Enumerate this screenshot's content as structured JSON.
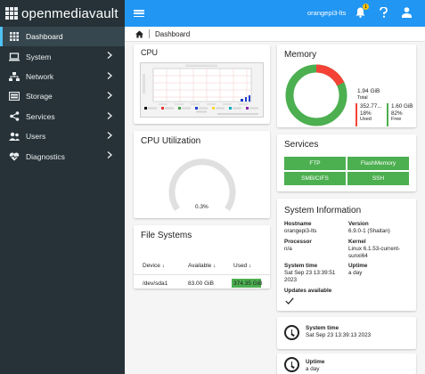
{
  "app": {
    "name": "openmediavault",
    "hostname": "orangepi3-lts",
    "notification_count": "1"
  },
  "sidebar": {
    "items": [
      {
        "label": "Dashboard",
        "icon": "dashboard-icon",
        "active": true
      },
      {
        "label": "System",
        "icon": "laptop-icon"
      },
      {
        "label": "Network",
        "icon": "network-icon"
      },
      {
        "label": "Storage",
        "icon": "storage-icon"
      },
      {
        "label": "Services",
        "icon": "share-icon"
      },
      {
        "label": "Users",
        "icon": "users-icon"
      },
      {
        "label": "Diagnostics",
        "icon": "heartbeat-icon"
      }
    ]
  },
  "breadcrumb": {
    "page": "Dashboard"
  },
  "cpu": {
    "title": "CPU"
  },
  "cpu_utilization": {
    "title": "CPU Utilization",
    "value": "0.3%",
    "percent": 0.3
  },
  "file_systems": {
    "title": "File Systems",
    "columns": [
      "Device",
      "Available",
      "Used"
    ],
    "rows": [
      {
        "device": "/dev/sda1",
        "available": "83.00 GiB",
        "used": "374.35 GiB"
      }
    ]
  },
  "memory": {
    "title": "Memory",
    "total_value": "1.94 GiB",
    "total_label": "Total",
    "used_value": "352.77...",
    "used_percent": "18%",
    "used_label": "Used",
    "free_value": "1.60 GiB",
    "free_percent": "82%",
    "free_label": "Free",
    "used_fraction": 0.18,
    "used_color": "#f44336",
    "free_color": "#4caf50"
  },
  "services": {
    "title": "Services",
    "items": [
      "FTP",
      "FlashMemory",
      "SMB/CIFS",
      "SSH"
    ]
  },
  "system_info": {
    "title": "System Information",
    "hostname_label": "Hostname",
    "hostname": "orangepi3-lts",
    "version_label": "Version",
    "version": "6.9.0-1 (Shaitan)",
    "processor_label": "Processor",
    "processor": "n/a",
    "kernel_label": "Kernel",
    "kernel": "Linux 6.1.53-current-sunxi64",
    "system_time_label": "System time",
    "system_time": "Sat Sep 23 13:39:51 2023",
    "uptime_label": "Uptime",
    "uptime": "a day",
    "updates_label": "Updates available"
  },
  "system_time_card": {
    "label": "System time",
    "value": "Sat Sep 23 13:39:13 2023"
  },
  "uptime_card": {
    "label": "Uptime",
    "value": "a day"
  }
}
